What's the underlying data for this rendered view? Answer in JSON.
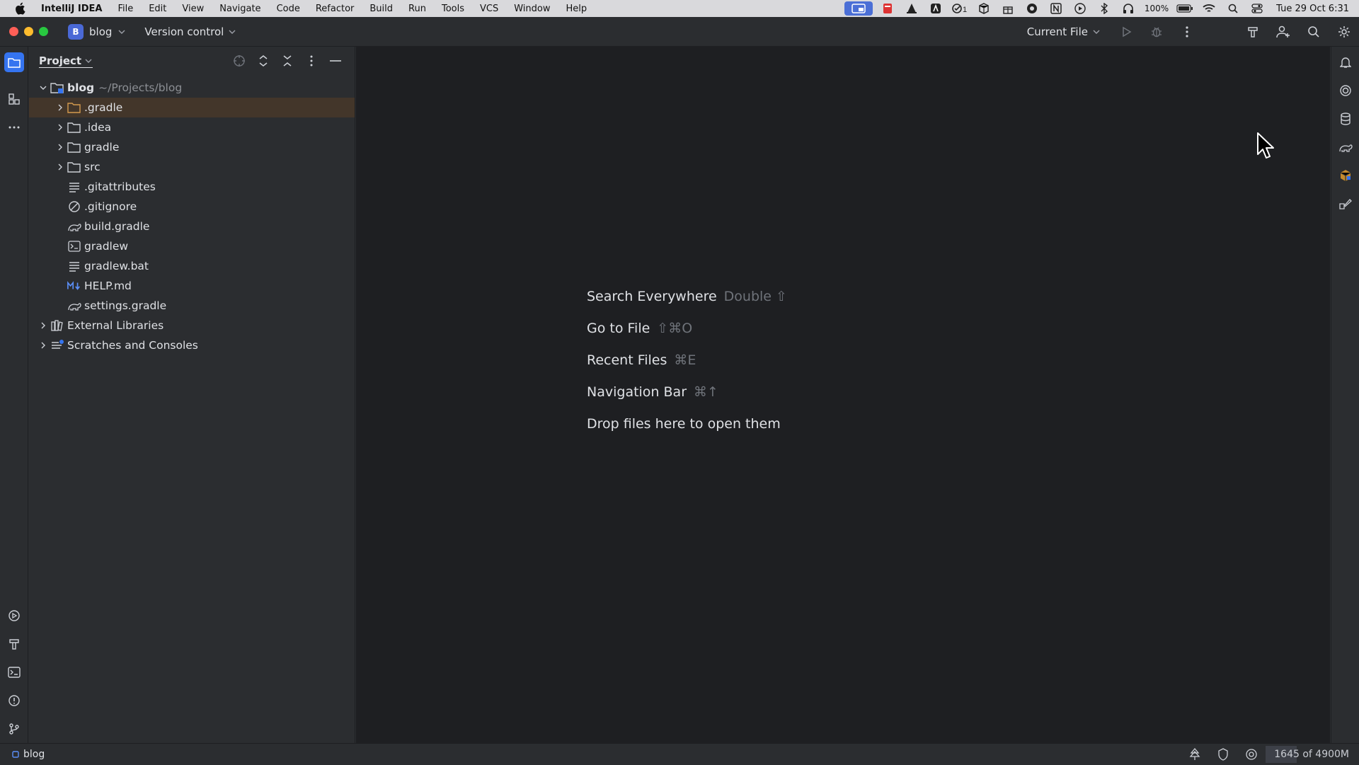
{
  "menubar": {
    "app_name": "IntelliJ IDEA",
    "items": [
      "File",
      "Edit",
      "View",
      "Navigate",
      "Code",
      "Refactor",
      "Build",
      "Run",
      "Tools",
      "VCS",
      "Window",
      "Help"
    ],
    "battery": "100%",
    "clock": "Tue 29 Oct 6:31"
  },
  "toolbar": {
    "project_badge": "B",
    "project_name": "blog",
    "vcs_label": "Version control",
    "run_config": "Current File"
  },
  "project_panel": {
    "title": "Project",
    "root": {
      "name": "blog",
      "path": "~/Projects/blog"
    },
    "items": [
      {
        "name": ".gradle",
        "type": "folder"
      },
      {
        "name": ".idea",
        "type": "folder"
      },
      {
        "name": "gradle",
        "type": "folder"
      },
      {
        "name": "src",
        "type": "folder"
      },
      {
        "name": ".gitattributes",
        "type": "text"
      },
      {
        "name": ".gitignore",
        "type": "ignore"
      },
      {
        "name": "build.gradle",
        "type": "gradle"
      },
      {
        "name": "gradlew",
        "type": "shell"
      },
      {
        "name": "gradlew.bat",
        "type": "text"
      },
      {
        "name": "HELP.md",
        "type": "markdown"
      },
      {
        "name": "settings.gradle",
        "type": "gradle"
      }
    ],
    "external_libraries": "External Libraries",
    "scratches": "Scratches and Consoles"
  },
  "editor_hints": [
    {
      "label": "Search Everywhere",
      "shortcut": "Double ⇧"
    },
    {
      "label": "Go to File",
      "shortcut": "⇧⌘O"
    },
    {
      "label": "Recent Files",
      "shortcut": "⌘E"
    },
    {
      "label": "Navigation Bar",
      "shortcut": "⌘↑"
    },
    {
      "label": "Drop files here to open them",
      "shortcut": ""
    }
  ],
  "statusbar": {
    "project": "blog",
    "memory": "1645 of 4900M",
    "memory_fraction": 0.336
  },
  "colors": {
    "accent": "#3574f0",
    "selection": "#43362a",
    "panel_bg": "#2b2d30",
    "editor_bg": "#1e1f22"
  }
}
